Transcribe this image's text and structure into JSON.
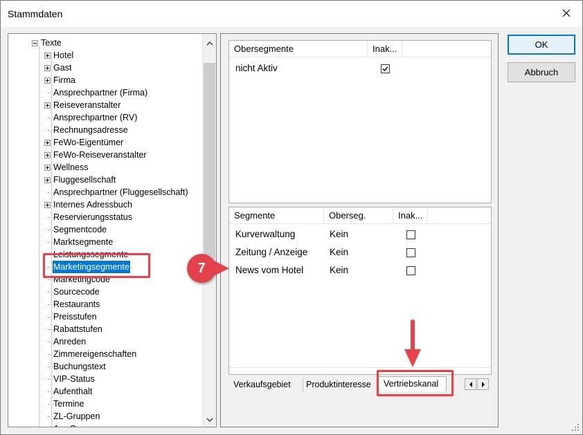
{
  "window": {
    "title": "Stammdaten"
  },
  "tree": {
    "root": "Texte",
    "items": [
      {
        "label": "Hotel",
        "expandable": true
      },
      {
        "label": "Gast",
        "expandable": true
      },
      {
        "label": "Firma",
        "expandable": true
      },
      {
        "label": "Ansprechpartner (Firma)",
        "expandable": false
      },
      {
        "label": "Reiseveranstalter",
        "expandable": true
      },
      {
        "label": "Ansprechpartner (RV)",
        "expandable": false
      },
      {
        "label": "Rechnungsadresse",
        "expandable": false
      },
      {
        "label": "FeWo-Eigentümer",
        "expandable": true
      },
      {
        "label": "FeWo-Reiseveranstalter",
        "expandable": true
      },
      {
        "label": "Wellness",
        "expandable": true
      },
      {
        "label": "Fluggesellschaft",
        "expandable": true
      },
      {
        "label": "Ansprechpartner (Fluggesellschaft)",
        "expandable": false
      },
      {
        "label": "Internes Adressbuch",
        "expandable": true
      },
      {
        "label": "Reservierungsstatus",
        "expandable": false
      },
      {
        "label": "Segmentcode",
        "expandable": false
      },
      {
        "label": "Marktsegmente",
        "expandable": false
      },
      {
        "label": "Leistungssegmente",
        "expandable": false
      },
      {
        "label": "Marketingsegmente",
        "expandable": false,
        "selected": true
      },
      {
        "label": "Marketingcode",
        "expandable": false
      },
      {
        "label": "Sourcecode",
        "expandable": false
      },
      {
        "label": "Restaurants",
        "expandable": false
      },
      {
        "label": "Preisstufen",
        "expandable": false
      },
      {
        "label": "Rabattstufen",
        "expandable": false
      },
      {
        "label": "Anreden",
        "expandable": false
      },
      {
        "label": "Zimmereigenschaften",
        "expandable": false
      },
      {
        "label": "Buchungstext",
        "expandable": false
      },
      {
        "label": "VIP-Status",
        "expandable": false
      },
      {
        "label": "Aufenthalt",
        "expandable": false
      },
      {
        "label": "Termine",
        "expandable": false
      },
      {
        "label": "ZL-Gruppen",
        "expandable": false
      },
      {
        "label": "Arr.-Gruppen",
        "expandable": false
      }
    ]
  },
  "upper_grid": {
    "headers": {
      "name": "Obersegmente",
      "inactive": "Inak..."
    },
    "rows": [
      {
        "name": "nicht Aktiv",
        "inactive": true
      }
    ]
  },
  "lower_grid": {
    "headers": {
      "name": "Segmente",
      "parent": "Oberseg.",
      "inactive": "Inak..."
    },
    "rows": [
      {
        "name": "Kurverwaltung",
        "parent": "Kein",
        "inactive": false
      },
      {
        "name": "Zeitung / Anzeige",
        "parent": "Kein",
        "inactive": false
      },
      {
        "name": "News vom Hotel",
        "parent": "Kein",
        "inactive": false
      }
    ]
  },
  "tabs": [
    "Verkaufsgebiet",
    "Produktinteresse",
    "Vertriebskanal"
  ],
  "active_tab": "Vertriebskanal",
  "buttons": {
    "ok": "OK",
    "cancel": "Abbruch"
  },
  "annotation": {
    "step": "7",
    "color": "#e8434b"
  },
  "colors": {
    "selection": "#0078d7",
    "default_button_border": "#0078d7"
  }
}
